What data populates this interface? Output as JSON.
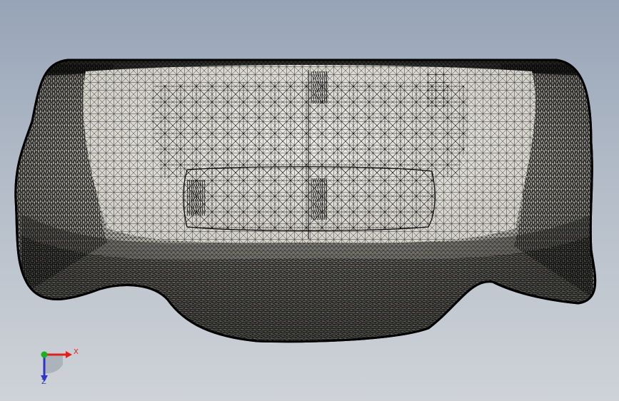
{
  "viewport": {
    "background_top": "#97a4b7",
    "background_bottom": "#cfd3d8"
  },
  "model": {
    "view": "mesh-wireframe",
    "shaded_color": "#d8d6cf",
    "mesh_line_color": "#000000"
  },
  "triad": {
    "x_label": "X",
    "z_label": "Z",
    "x_color": "#e0201c",
    "y_color": "#19b21c",
    "z_color": "#2a35c9"
  }
}
